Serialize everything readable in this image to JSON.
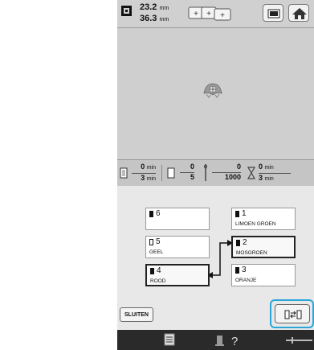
{
  "topbar": {
    "width_value": "23.2",
    "height_value": "36.3",
    "unit": "mm"
  },
  "stats": {
    "time_elapsed": "0",
    "time_total": "3",
    "time_unit": "min",
    "color_current": "0",
    "color_total": "5",
    "stitch_current": "0",
    "stitch_total": "1000",
    "remaining_top": "0",
    "remaining_bottom": "3",
    "remaining_unit": "min"
  },
  "colors": [
    {
      "num": "6",
      "name": "",
      "filled": true
    },
    {
      "num": "5",
      "name": "GEEL",
      "filled": false
    },
    {
      "num": "4",
      "name": "ROOD",
      "filled": true
    },
    {
      "num": "1",
      "name": "LIMOEN GROEN",
      "filled": true
    },
    {
      "num": "2",
      "name": "MOSGROEN",
      "filled": true
    },
    {
      "num": "3",
      "name": "ORANJE",
      "filled": true
    }
  ],
  "buttons": {
    "close_label": "SLUITEN"
  },
  "colors_theme": {
    "highlight": "#2aa7d8",
    "screen_bg": "#cfcfcf",
    "status_bar": "#2a2a2a"
  },
  "icons": [
    "size-icon",
    "combine-icon",
    "frame-icon",
    "home-icon",
    "spool-icon",
    "needle-icon",
    "hourglass-icon",
    "swap-icon",
    "list-icon",
    "help-icon"
  ]
}
